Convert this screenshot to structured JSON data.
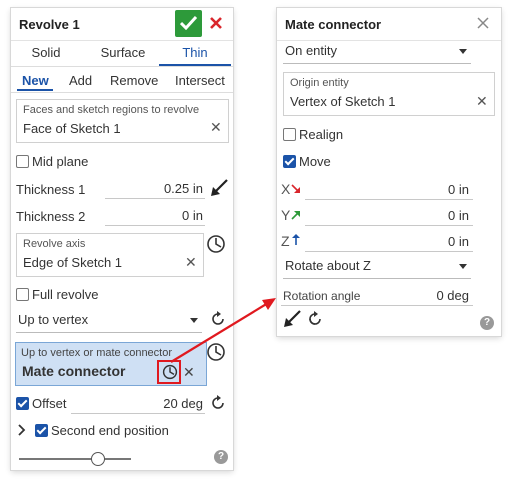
{
  "revolve": {
    "title": "Revolve 1",
    "tabs": [
      "Solid",
      "Surface",
      "Thin"
    ],
    "active_tab": "Thin",
    "ops": [
      "New",
      "Add",
      "Remove",
      "Intersect"
    ],
    "active_op": "New",
    "faces_label": "Faces and sketch regions to revolve",
    "faces_value": "Face of Sketch 1",
    "mid_plane": "Mid plane",
    "mid_plane_checked": false,
    "thickness1_label": "Thickness 1",
    "thickness1_value": "0.25 in",
    "thickness2_label": "Thickness 2",
    "thickness2_value": "0 in",
    "axis_label": "Revolve axis",
    "axis_value": "Edge of Sketch 1",
    "full_revolve": "Full revolve",
    "full_revolve_checked": false,
    "end_type": "Up to vertex",
    "upto_label": "Up to vertex or mate connector",
    "upto_value": "Mate connector",
    "offset_label": "Offset",
    "offset_checked": true,
    "offset_value": "20 deg",
    "second_end": "Second end position",
    "second_end_checked": true,
    "slider_value": 0.7
  },
  "mate": {
    "title": "Mate connector",
    "mode": "On entity",
    "origin_label": "Origin entity",
    "origin_value": "Vertex of Sketch 1",
    "realign": "Realign",
    "realign_checked": false,
    "move": "Move",
    "move_checked": true,
    "x_label": "X",
    "x_value": "0 in",
    "y_label": "Y",
    "y_value": "0 in",
    "z_label": "Z",
    "z_value": "0 in",
    "rotate": "Rotate about Z",
    "rotation_label": "Rotation angle",
    "rotation_value": "0 deg"
  },
  "colors": {
    "accent": "#1b53a8",
    "ok_green": "#2d9a3a",
    "cancel_red": "#d9262c",
    "highlight": "#cfe0f4",
    "callout_red": "#e0191f"
  }
}
